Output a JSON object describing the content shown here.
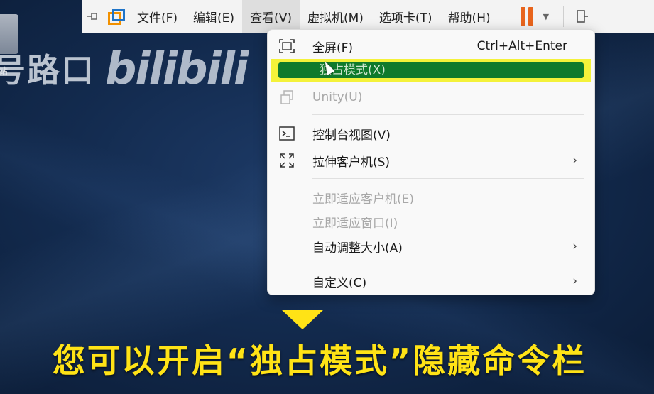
{
  "desktop": {
    "icon_label": "站"
  },
  "watermark": {
    "text": "号路口",
    "logo": "bilibili"
  },
  "menubar": {
    "items": [
      {
        "label": "文件(F)"
      },
      {
        "label": "编辑(E)"
      },
      {
        "label": "查看(V)"
      },
      {
        "label": "虚拟机(M)"
      },
      {
        "label": "选项卡(T)"
      },
      {
        "label": "帮助(H)"
      }
    ],
    "colors": {
      "pause": "#e8641c",
      "vm_orange": "#f29100",
      "vm_blue": "#1f74c8"
    }
  },
  "view_menu": {
    "items": [
      {
        "label": "全屏(F)",
        "shortcut": "Ctrl+Alt+Enter",
        "icon": "fullscreen-icon",
        "enabled": true
      },
      {
        "label": "独占模式(X)",
        "icon": "",
        "enabled": true,
        "highlighted": true
      },
      {
        "label": "Unity(U)",
        "icon": "unity-icon",
        "enabled": false
      },
      {
        "label": "控制台视图(V)",
        "icon": "console-icon",
        "enabled": true
      },
      {
        "label": "拉伸客户机(S)",
        "icon": "stretch-icon",
        "enabled": true,
        "submenu": true
      },
      {
        "label": "立即适应客户机(E)",
        "enabled": false
      },
      {
        "label": "立即适应窗口(I)",
        "enabled": false
      },
      {
        "label": "自动调整大小(A)",
        "enabled": true,
        "submenu": true
      },
      {
        "label": "自定义(C)",
        "enabled": true,
        "submenu": true
      }
    ],
    "submenu_arrow": "›",
    "highlight_colors": {
      "outline": "#f4f23a",
      "fill": "#0f7a2c"
    }
  },
  "caption": {
    "text": "您可以开启“独占模式”隐藏命令栏",
    "color": "#ffe316"
  }
}
